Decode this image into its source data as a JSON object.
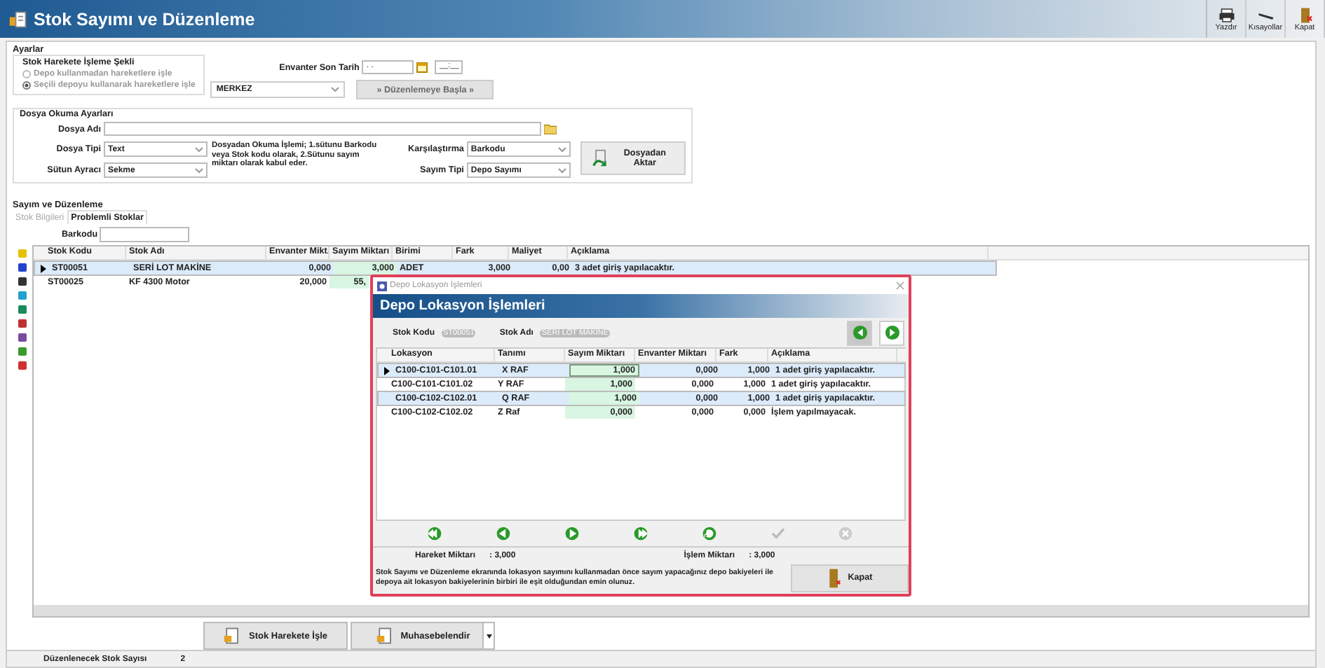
{
  "window": {
    "title": "Stok Sayımı ve Düzenleme"
  },
  "toolbar": [
    {
      "label": "Yazdır",
      "kind": "print"
    },
    {
      "label": "Kısayollar",
      "kind": "keys"
    },
    {
      "label": "Kapat",
      "kind": "close"
    }
  ],
  "settings": {
    "title": "Ayarlar",
    "mode_group": {
      "title": "Stok Harekete İşleme Şekli",
      "disabled": true,
      "options": [
        {
          "label": "Depo kullanmadan hareketlere işle",
          "selected": false
        },
        {
          "label": "Seçili depoyu kullanarak hareketlere işle",
          "selected": true
        }
      ]
    },
    "warehouse": "MERKEZ",
    "inventory_date": {
      "label": "Envanter Son Tarih",
      "date": ". .",
      "time": "__:__"
    },
    "start_button": {
      "label": "» Düzenlemeye Başla »",
      "disabled": true
    }
  },
  "file_settings": {
    "title": "Dosya Okuma Ayarları",
    "file_name_label": "Dosya Adı",
    "file_type": {
      "label": "Dosya Tipi",
      "value": "Text"
    },
    "separator": {
      "label": "Sütun Ayracı",
      "value": "Sekme"
    },
    "note": "Dosyadan Okuma İşlemi; 1.sütunu Barkodu veya Stok kodu olarak, 2.Sütunu sayım miktarı olarak kabul eder.",
    "compare": {
      "label": "Karşılaştırma",
      "value": "Barkodu"
    },
    "count_type": {
      "label": "Sayım Tipi",
      "value": "Depo Sayımı"
    },
    "import_button": "Dosyadan Aktar"
  },
  "counting": {
    "title": "Sayım ve Düzenleme",
    "tabs": [
      {
        "label": "Stok Bilgileri",
        "selected": false
      },
      {
        "label": "Problemli Stoklar",
        "selected": true
      }
    ],
    "barcode_label": "Barkodu",
    "columns": [
      "Stok Kodu",
      "Stok Adı",
      "Envanter Mikt.",
      "Sayım Miktarı",
      "Birimi",
      "Fark",
      "Maliyet",
      "Açıklama"
    ],
    "rows": [
      {
        "selected": true,
        "cells": [
          "ST00051",
          "SERİ LOT MAKİNE",
          "0,000",
          "3,000",
          "ADET",
          "3,000",
          "0,00",
          "3 adet giriş yapılacaktır."
        ]
      },
      {
        "selected": false,
        "cells": [
          "ST00025",
          "KF 4300 Motor",
          "20,000",
          "55,"
        ]
      }
    ]
  },
  "bottom_buttons": [
    {
      "label": "Stok Harekete İşle",
      "dropdown": false
    },
    {
      "label": "Muhasebelendir",
      "dropdown": true
    }
  ],
  "status_bar": {
    "label": "Düzenlenecek Stok Sayısı",
    "value": "2"
  },
  "dialog": {
    "title": "Depo Lokasyon İşlemleri",
    "header": "Depo Lokasyon İşlemleri",
    "stock_code_label": "Stok Kodu",
    "stock_code": "ST00051",
    "stock_name_label": "Stok Adı",
    "stock_name": "SERİ LOT MAKİNE",
    "columns": [
      "Lokasyon",
      "Tanımı",
      "Sayım Miktarı",
      "Envanter Miktarı",
      "Fark",
      "Açıklama"
    ],
    "rows": [
      {
        "current": true,
        "selected": true,
        "cells": [
          "C100-C101-C101.01",
          "X RAF",
          "1,000",
          "0,000",
          "1,000",
          "1 adet giriş yapılacaktır."
        ]
      },
      {
        "current": false,
        "selected": false,
        "cells": [
          "C100-C101-C101.02",
          "Y RAF",
          "1,000",
          "0,000",
          "1,000",
          "1 adet giriş yapılacaktır."
        ]
      },
      {
        "current": false,
        "selected": true,
        "cells": [
          "C100-C102-C102.01",
          "Q RAF",
          "1,000",
          "0,000",
          "1,000",
          "1 adet giriş yapılacaktır."
        ]
      },
      {
        "current": false,
        "selected": false,
        "cells": [
          "C100-C102-C102.02",
          "Z Raf",
          "0,000",
          "0,000",
          "0,000",
          "İşlem yapılmayacak."
        ]
      }
    ],
    "nav_buttons": [
      {
        "kind": "first",
        "disabled": false
      },
      {
        "kind": "prev",
        "disabled": false
      },
      {
        "kind": "next",
        "disabled": false
      },
      {
        "kind": "last",
        "disabled": false
      },
      {
        "kind": "refresh",
        "disabled": false
      },
      {
        "kind": "confirm",
        "disabled": true
      },
      {
        "kind": "cancel",
        "disabled": true
      }
    ],
    "totals": [
      {
        "label": "Hareket Miktarı",
        "value": ": 3,000"
      },
      {
        "label": "İşlem Miktarı",
        "value": ": 3,000"
      }
    ],
    "note": "Stok Sayımı ve Düzenleme ekranında lokasyon sayımını kullanmadan önce sayım yapacağınız depo bakiyeleri ile depoya ait lokasyon bakiyelerinin birbiri ile eşit olduğundan emin olunuz.",
    "close_button": "Kapat"
  }
}
